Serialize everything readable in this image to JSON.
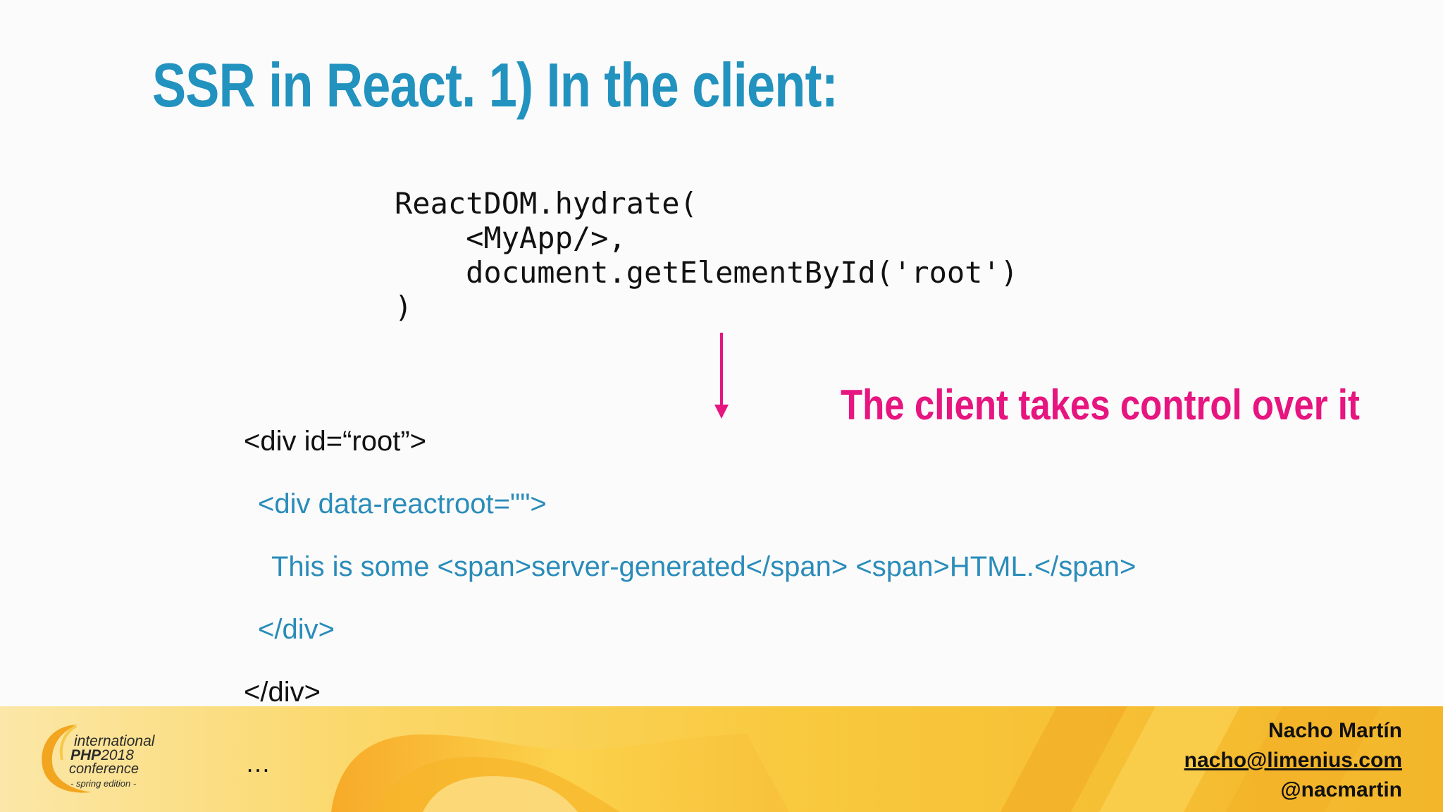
{
  "slide": {
    "title": "SSR in React. 1) In the client:",
    "code_lines": [
      "ReactDOM.hydrate(",
      "    <MyApp/>,",
      "    document.getElementById('root')",
      ")"
    ],
    "callout": "The client takes control over it",
    "html_lines": [
      "<div id=“root”>",
      "<div data-reactroot=\"\">",
      "This is some <span>server-generated</span> <span>HTML.</span>",
      "</div>",
      "</div>"
    ],
    "ellipsis": "…"
  },
  "conference_logo": {
    "line1": "international",
    "line2a": "PHP",
    "line2b": "2018",
    "line3": "conference",
    "line4": "- spring edition -"
  },
  "author": {
    "name": "Nacho Martín",
    "email": "nacho@limenius.com",
    "handle": "@nacmartin"
  },
  "colors": {
    "title": "#2292bf",
    "callout": "#e6157f",
    "html_markup": "#2a8cba",
    "footer_band": "#f7c532"
  }
}
